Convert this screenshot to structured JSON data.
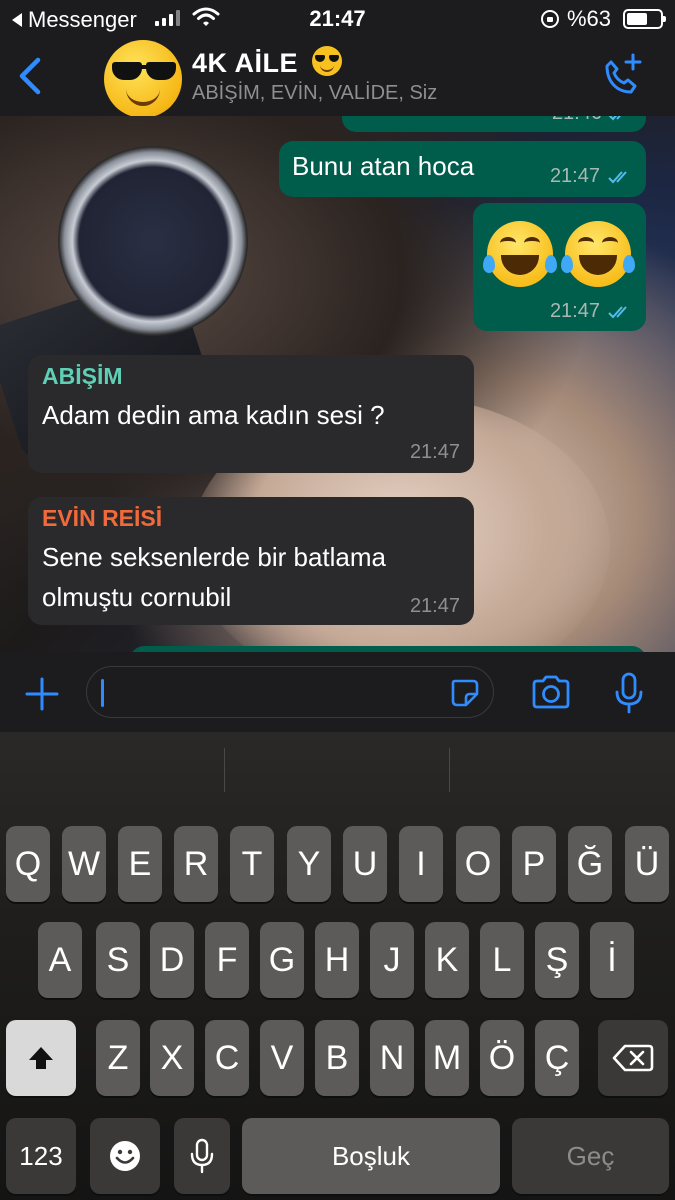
{
  "status_bar": {
    "back_app": "Messenger",
    "time": "21:47",
    "battery_text": "%63",
    "battery_level": 0.63
  },
  "header": {
    "title": "4K AİLE",
    "title_emoji": "smiling-face-with-sunglasses",
    "subtitle": "ABİŞİM, EVİN, VALİDE, Siz",
    "back_icon": "chevron-left-icon",
    "action_icon": "phone-add-icon"
  },
  "messages": [
    {
      "direction": "out",
      "text": "",
      "time": "21:46",
      "read": true
    },
    {
      "direction": "out",
      "text": "Bunu atan hoca",
      "time": "21:47",
      "read": true
    },
    {
      "direction": "out",
      "emoji": [
        "face-with-tears-of-joy",
        "face-with-tears-of-joy"
      ],
      "time": "21:47",
      "read": true
    },
    {
      "direction": "in",
      "sender": "ABİŞİM",
      "sender_color": "#5fd0b5",
      "lines": [
        "Adam dedin ama kadın sesi ?"
      ],
      "time": "21:47"
    },
    {
      "direction": "in",
      "sender": "EVİN REİSİ",
      "sender_color": "#f06a3c",
      "lines": [
        "Sene seksenlerde bir batlama",
        "olmuştu cornubil"
      ],
      "time": "21:47"
    }
  ],
  "input_bar": {
    "value": "",
    "icons": [
      "plus-icon",
      "sticker-icon",
      "camera-icon",
      "microphone-icon"
    ]
  },
  "keyboard": {
    "row1": [
      "Q",
      "W",
      "E",
      "R",
      "T",
      "Y",
      "U",
      "I",
      "O",
      "P",
      "Ğ",
      "Ü"
    ],
    "row2": [
      "A",
      "S",
      "D",
      "F",
      "G",
      "H",
      "J",
      "K",
      "L",
      "Ş",
      "İ"
    ],
    "row3": [
      "Z",
      "X",
      "C",
      "V",
      "B",
      "N",
      "M",
      "Ö",
      "Ç"
    ],
    "numbers_label": "123",
    "space_label": "Boşluk",
    "go_label": "Geç"
  },
  "colors": {
    "accent": "#2f8cff",
    "outgoing_bubble": "#005c4b",
    "incoming_bubble": "#2a2a2c"
  }
}
